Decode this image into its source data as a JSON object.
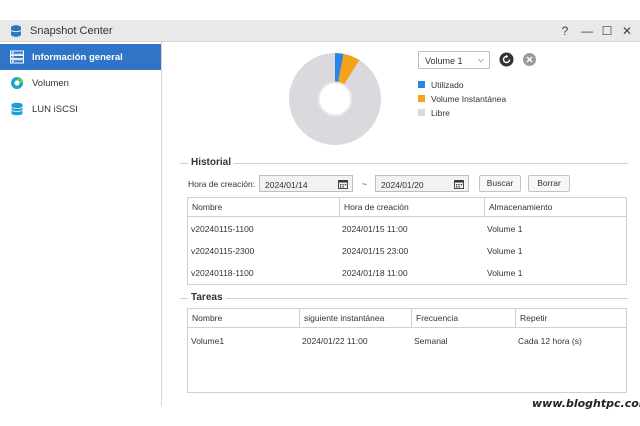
{
  "window": {
    "title": "Snapshot Center",
    "controls": {
      "help": "?",
      "minimize": "—",
      "maximize": "☐",
      "close": "✕"
    }
  },
  "sidebar": {
    "items": [
      {
        "label": "Información general",
        "icon": "overview-icon",
        "active": true
      },
      {
        "label": "Volumen",
        "icon": "volume-icon",
        "active": false
      },
      {
        "label": "LUN iSCSI",
        "icon": "lun-icon",
        "active": false
      }
    ]
  },
  "overview": {
    "volume_select": "Volume 1",
    "chart_data": {
      "type": "pie",
      "categories": [
        "Utilizado",
        "Volume Instantánea",
        "Libre"
      ],
      "values": [
        3,
        6,
        91
      ],
      "colors": [
        "#2a86e0",
        "#f5a21b",
        "#d9d9de"
      ],
      "legend_position": "right"
    }
  },
  "history": {
    "title": "Historial",
    "date_label": "Hora de creación:",
    "from": "2024/01/14",
    "separator": "~",
    "to": "2024/01/20",
    "search_button": "Buscar",
    "clear_button": "Borrar",
    "columns": [
      "Nombre",
      "Hora de creación",
      "Almacenamiento"
    ],
    "rows": [
      [
        "v20240115-1100",
        "2024/01/15 11:00",
        "Volume 1"
      ],
      [
        "v20240115-2300",
        "2024/01/15 23:00",
        "Volume 1"
      ],
      [
        "v20240118-1100",
        "2024/01/18 11:00",
        "Volume 1"
      ]
    ]
  },
  "tasks": {
    "title": "Tareas",
    "columns": [
      "Nombre",
      "siguiente instantánea",
      "Frecuencia",
      "Repetir"
    ],
    "rows": [
      [
        "Volume1",
        "2024/01/22 11:00",
        "Semanal",
        "Cada 12 hora (s)"
      ]
    ]
  },
  "watermark": "www.bloghtpc.com"
}
